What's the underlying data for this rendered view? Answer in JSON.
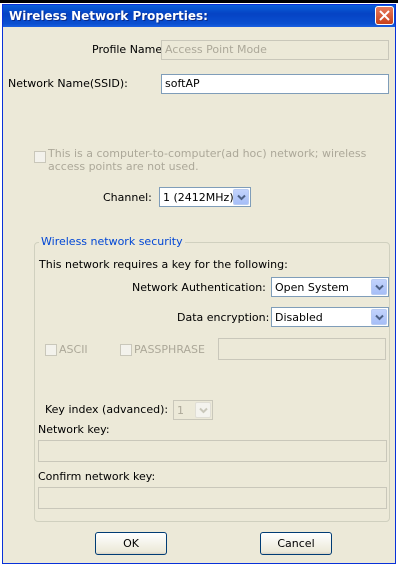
{
  "dialog": {
    "title": "Wireless Network Properties:"
  },
  "profile": {
    "label": "Profile Name:",
    "value": "Access Point Mode"
  },
  "ssid": {
    "label": "Network Name(SSID):",
    "value": "softAP"
  },
  "adhoc": {
    "line1": "This is a computer-to-computer(ad hoc) network; wireless",
    "line2": "access points are not used.",
    "checked": false
  },
  "channel": {
    "label": "Channel:",
    "value": "1  (2412MHz)"
  },
  "security": {
    "legend": "Wireless network security",
    "description": "This network requires a key for the following:",
    "auth_label": "Network Authentication:",
    "auth_value": "Open System",
    "enc_label": "Data encryption:",
    "enc_value": "Disabled",
    "ascii_label": "ASCII",
    "passphrase_label": "PASSPHRASE",
    "passphrase_value": "",
    "key_index_label": "Key index (advanced):",
    "key_index_value": "1",
    "network_key_label": "Network key:",
    "network_key_value": "",
    "confirm_key_label": "Confirm network key:",
    "confirm_key_value": ""
  },
  "buttons": {
    "ok": "OK",
    "cancel": "Cancel"
  },
  "colors": {
    "titlebar": "#0543c4",
    "window_bg": "#ece9d8",
    "legend_text": "#0046d5",
    "disabled_text": "#aca899"
  }
}
